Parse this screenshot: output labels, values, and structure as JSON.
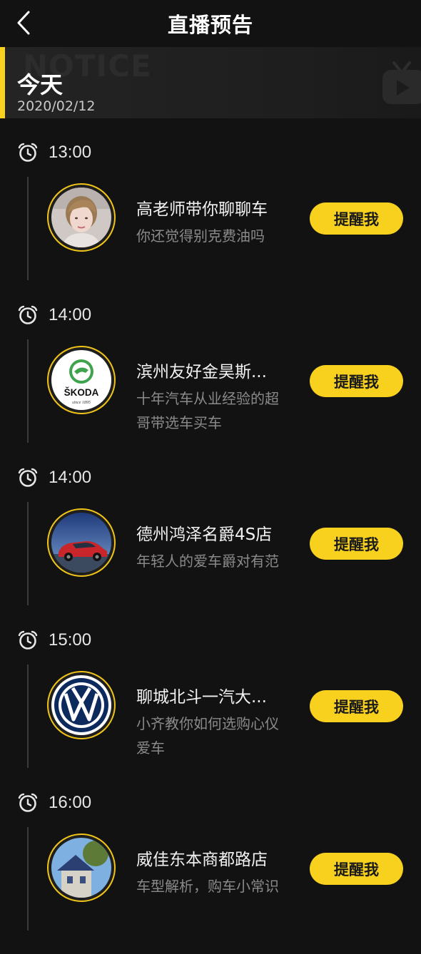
{
  "header": {
    "title": "直播预告",
    "back_icon": "chevron-left-icon"
  },
  "banner": {
    "watermark": "NOTICE",
    "day_label": "今天",
    "date": "2020/02/12",
    "accent_color": "#f7d11e",
    "tv_icon": "tv-play-icon"
  },
  "schedule": [
    {
      "time": "13:00",
      "title": "高老师带你聊聊车",
      "description": "你还觉得别克费油吗",
      "avatar": "person-photo",
      "button_label": "提醒我"
    },
    {
      "time": "14:00",
      "title": "滨州友好金昊斯...",
      "description": "十年汽车从业经验的超哥带选车买车",
      "avatar": "skoda-logo",
      "logo_text": "ŠKODA",
      "button_label": "提醒我"
    },
    {
      "time": "14:00",
      "title": "德州鸿泽名爵4S店",
      "description": "年轻人的爱车爵对有范",
      "avatar": "red-car-photo",
      "button_label": "提醒我"
    },
    {
      "time": "15:00",
      "title": "聊城北斗一汽大...",
      "description": "小齐教你如何选购心仪爱车",
      "avatar": "volkswagen-logo",
      "button_label": "提醒我"
    },
    {
      "time": "16:00",
      "title": "威佳东本商都路店",
      "description": "车型解析，购车小常识",
      "avatar": "house-photo",
      "button_label": "提醒我"
    }
  ],
  "colors": {
    "background": "#121212",
    "accent": "#f7d11e",
    "secondary_text": "#8a8a8a"
  }
}
